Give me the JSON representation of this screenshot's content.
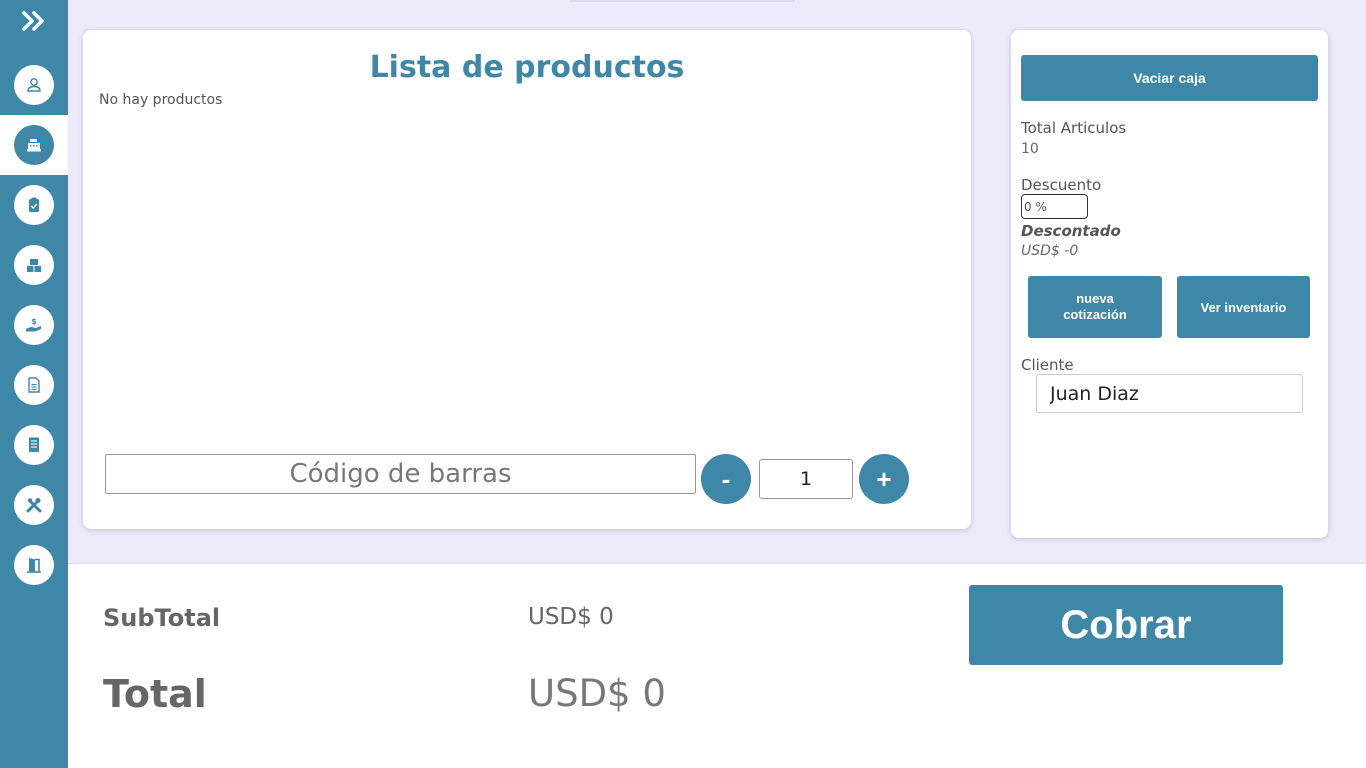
{
  "sidebar": {
    "items": [
      {
        "name": "user-icon"
      },
      {
        "name": "cash-register-icon",
        "active": true
      },
      {
        "name": "clipboard-check-icon"
      },
      {
        "name": "boxes-icon"
      },
      {
        "name": "hand-dollar-icon"
      },
      {
        "name": "document-icon"
      },
      {
        "name": "receipt-icon"
      },
      {
        "name": "tools-icon"
      },
      {
        "name": "exit-door-icon"
      }
    ]
  },
  "products": {
    "title": "Lista de productos",
    "empty_text": "No hay productos",
    "barcode_placeholder": "Código de barras",
    "minus_label": "-",
    "plus_label": "+",
    "quantity": "1"
  },
  "side": {
    "vaciar_label": "Vaciar caja",
    "total_articulos_label": "Total Articulos",
    "total_articulos_value": "10",
    "descuento_label": "Descuento",
    "descuento_value": "0 %",
    "descontado_label": "Descontado",
    "descontado_value": "USD$ -0",
    "cotizacion_label_1": "nueva",
    "cotizacion_label_2": "cotización",
    "inventario_label": "Ver inventario",
    "cliente_label": "Cliente",
    "cliente_value": "Juan Diaz"
  },
  "totals": {
    "subtotal_label": "SubTotal",
    "subtotal_value": "USD$ 0",
    "total_label": "Total",
    "total_value": "USD$ 0",
    "cobrar_label": "Cobrar"
  },
  "colors": {
    "accent": "#3e87a6",
    "background": "#eceafb"
  }
}
